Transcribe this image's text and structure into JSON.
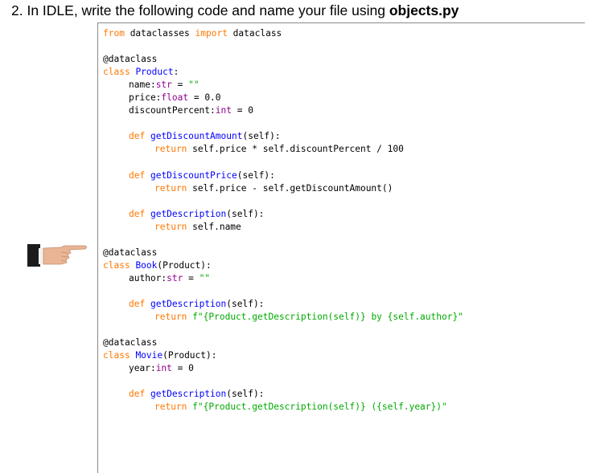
{
  "instruction": {
    "prefix": "2. In IDLE, write the following code and name your file using ",
    "filename": "objects.py"
  },
  "hand_icon": "pointing-hand-icon",
  "code_lines": [
    {
      "indent": 0,
      "tokens": [
        {
          "t": "from",
          "c": "kw"
        },
        {
          "t": " dataclasses ",
          "c": ""
        },
        {
          "t": "import",
          "c": "kw"
        },
        {
          "t": " dataclass",
          "c": ""
        }
      ]
    },
    {
      "indent": 0,
      "tokens": []
    },
    {
      "indent": 0,
      "tokens": [
        {
          "t": "@dataclass",
          "c": ""
        }
      ]
    },
    {
      "indent": 0,
      "tokens": [
        {
          "t": "class",
          "c": "kw"
        },
        {
          "t": " ",
          "c": ""
        },
        {
          "t": "Product",
          "c": "def"
        },
        {
          "t": ":",
          "c": ""
        }
      ]
    },
    {
      "indent": 1,
      "tokens": [
        {
          "t": "name:",
          "c": ""
        },
        {
          "t": "str",
          "c": "bi"
        },
        {
          "t": " = ",
          "c": ""
        },
        {
          "t": "\"\"",
          "c": "str"
        }
      ]
    },
    {
      "indent": 1,
      "tokens": [
        {
          "t": "price:",
          "c": ""
        },
        {
          "t": "float",
          "c": "bi"
        },
        {
          "t": " = 0.0",
          "c": ""
        }
      ]
    },
    {
      "indent": 1,
      "tokens": [
        {
          "t": "discountPercent:",
          "c": ""
        },
        {
          "t": "int",
          "c": "bi"
        },
        {
          "t": " = 0",
          "c": ""
        }
      ]
    },
    {
      "indent": 0,
      "tokens": []
    },
    {
      "indent": 1,
      "tokens": [
        {
          "t": "def",
          "c": "kw"
        },
        {
          "t": " ",
          "c": ""
        },
        {
          "t": "getDiscountAmount",
          "c": "def"
        },
        {
          "t": "(self):",
          "c": ""
        }
      ]
    },
    {
      "indent": 2,
      "tokens": [
        {
          "t": "return",
          "c": "kw"
        },
        {
          "t": " self.price * self.discountPercent / 100",
          "c": ""
        }
      ]
    },
    {
      "indent": 0,
      "tokens": []
    },
    {
      "indent": 1,
      "tokens": [
        {
          "t": "def",
          "c": "kw"
        },
        {
          "t": " ",
          "c": ""
        },
        {
          "t": "getDiscountPrice",
          "c": "def"
        },
        {
          "t": "(self):",
          "c": ""
        }
      ]
    },
    {
      "indent": 2,
      "tokens": [
        {
          "t": "return",
          "c": "kw"
        },
        {
          "t": " self.price - self.getDiscountAmount()",
          "c": ""
        }
      ]
    },
    {
      "indent": 0,
      "tokens": []
    },
    {
      "indent": 1,
      "tokens": [
        {
          "t": "def",
          "c": "kw"
        },
        {
          "t": " ",
          "c": ""
        },
        {
          "t": "getDescription",
          "c": "def"
        },
        {
          "t": "(self):",
          "c": ""
        }
      ]
    },
    {
      "indent": 2,
      "tokens": [
        {
          "t": "return",
          "c": "kw"
        },
        {
          "t": " self.name",
          "c": ""
        }
      ]
    },
    {
      "indent": 0,
      "tokens": []
    },
    {
      "indent": 0,
      "tokens": [
        {
          "t": "@dataclass",
          "c": ""
        }
      ]
    },
    {
      "indent": 0,
      "tokens": [
        {
          "t": "class",
          "c": "kw"
        },
        {
          "t": " ",
          "c": ""
        },
        {
          "t": "Book",
          "c": "def"
        },
        {
          "t": "(Product):",
          "c": ""
        }
      ]
    },
    {
      "indent": 1,
      "tokens": [
        {
          "t": "author:",
          "c": ""
        },
        {
          "t": "str",
          "c": "bi"
        },
        {
          "t": " = ",
          "c": ""
        },
        {
          "t": "\"\"",
          "c": "str"
        }
      ]
    },
    {
      "indent": 0,
      "tokens": []
    },
    {
      "indent": 1,
      "tokens": [
        {
          "t": "def",
          "c": "kw"
        },
        {
          "t": " ",
          "c": ""
        },
        {
          "t": "getDescription",
          "c": "def"
        },
        {
          "t": "(self):",
          "c": ""
        }
      ]
    },
    {
      "indent": 2,
      "tokens": [
        {
          "t": "return",
          "c": "kw"
        },
        {
          "t": " ",
          "c": ""
        },
        {
          "t": "f\"{Product.getDescription(self)} by {self.author}\"",
          "c": "str"
        }
      ]
    },
    {
      "indent": 0,
      "tokens": []
    },
    {
      "indent": 0,
      "tokens": [
        {
          "t": "@dataclass",
          "c": ""
        }
      ]
    },
    {
      "indent": 0,
      "tokens": [
        {
          "t": "class",
          "c": "kw"
        },
        {
          "t": " ",
          "c": ""
        },
        {
          "t": "Movie",
          "c": "def"
        },
        {
          "t": "(Product):",
          "c": ""
        }
      ]
    },
    {
      "indent": 1,
      "tokens": [
        {
          "t": "year:",
          "c": ""
        },
        {
          "t": "int",
          "c": "bi"
        },
        {
          "t": " = 0",
          "c": ""
        }
      ]
    },
    {
      "indent": 0,
      "tokens": []
    },
    {
      "indent": 1,
      "tokens": [
        {
          "t": "def",
          "c": "kw"
        },
        {
          "t": " ",
          "c": ""
        },
        {
          "t": "getDescription",
          "c": "def"
        },
        {
          "t": "(self):",
          "c": ""
        }
      ]
    },
    {
      "indent": 2,
      "tokens": [
        {
          "t": "return",
          "c": "kw"
        },
        {
          "t": " ",
          "c": ""
        },
        {
          "t": "f\"{Product.getDescription(self)} ({self.year})\"",
          "c": "str"
        }
      ]
    }
  ]
}
